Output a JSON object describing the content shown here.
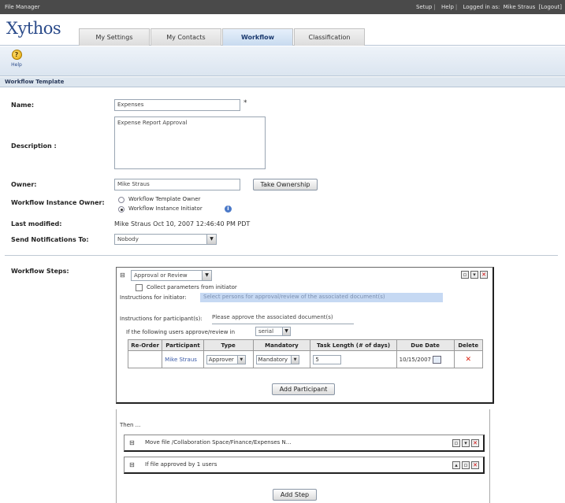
{
  "topbar": {
    "app_name": "File Manager",
    "links": [
      "Setup",
      "Help",
      "Logged in as:",
      "Mike Straus",
      "[Logout]"
    ]
  },
  "logo": "Xythos",
  "tabs": [
    {
      "label": "My Settings",
      "active": false
    },
    {
      "label": "My Contacts",
      "active": false
    },
    {
      "label": "Workflow",
      "active": true
    },
    {
      "label": "Classification",
      "active": false
    }
  ],
  "toolbar": {
    "help_label": "Help",
    "help_icon": "help-circle-icon"
  },
  "section_title": "Workflow Template",
  "form": {
    "name_label": "Name:",
    "name_value": "Expenses",
    "required_marker": "*",
    "description_label": "Description :",
    "description_value": "Expense Report Approval",
    "owner_label": "Owner:",
    "owner_value": "Mike Straus",
    "take_ownership_label": "Take Ownership",
    "instance_owner_label": "Workflow Instance Owner:",
    "instance_owner_options": [
      {
        "label": "Workflow Template Owner",
        "selected": false
      },
      {
        "label": "Workflow Instance Initiator",
        "selected": true
      }
    ],
    "last_modified_label": "Last modified:",
    "last_modified_value": "Mike Straus   Oct 10, 2007 12:46:40 PM PDT",
    "notify_label": "Send Notifications To:",
    "notify_value": "Nobody"
  },
  "steps": {
    "label": "Workflow Steps:",
    "step_type": "Approval or Review",
    "collect_params_label": "Collect parameters from initiator",
    "instr_initiator_label": "Instructions for initiator:",
    "instr_initiator_value": "Select persons for approval/review of the associated document(s)",
    "instr_participant_label": "Instructions for participant(s):",
    "instr_participant_value": "Please approve the associated document(s)",
    "condition_label": "If the following users approve/review in",
    "condition_value": "serial",
    "columns": [
      "Re-Order",
      "Participant",
      "Type",
      "Mandatory",
      "Task Length (# of days)",
      "Due Date",
      "Delete"
    ],
    "rows": [
      {
        "participant": "Mike Straus",
        "type": "Approver",
        "mandatory": "Mandatory",
        "task_length": "5",
        "due_date": "10/15/2007"
      }
    ],
    "add_participant_label": "Add Participant"
  },
  "lower": {
    "then_label": "Then ...",
    "sub_steps": [
      {
        "text": "Move file /Collaboration Space/Finance/Expenses N..."
      },
      {
        "text": "If file approved by 1 users"
      }
    ],
    "add_step_label": "Add Step"
  }
}
